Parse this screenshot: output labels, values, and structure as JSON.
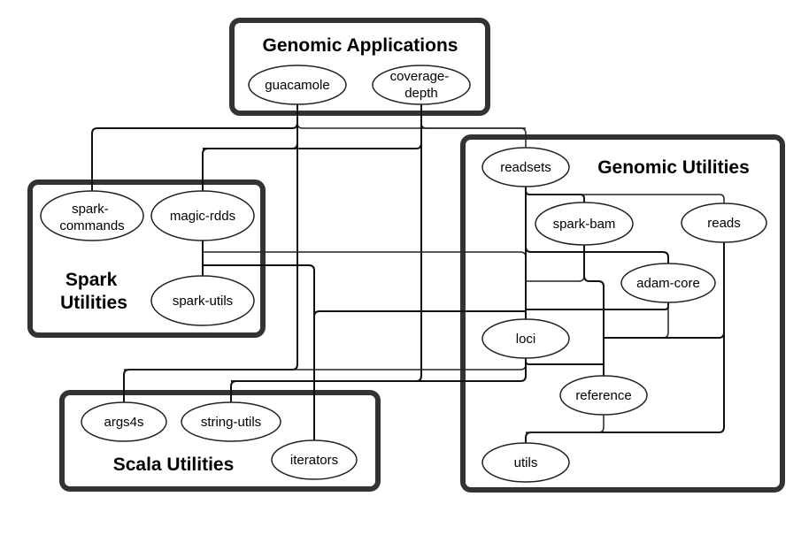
{
  "diagram": {
    "groups": [
      {
        "id": "genomic-applications",
        "title": [
          "Genomic Applications"
        ]
      },
      {
        "id": "spark-utilities",
        "title": [
          "Spark",
          "Utilities"
        ]
      },
      {
        "id": "genomic-utilities",
        "title": [
          "Genomic Utilities"
        ]
      },
      {
        "id": "scala-utilities",
        "title": [
          "Scala Utilities"
        ]
      }
    ],
    "nodes": [
      {
        "id": "guacamole",
        "group": "genomic-applications",
        "label": [
          "guacamole"
        ]
      },
      {
        "id": "coverage-depth",
        "group": "genomic-applications",
        "label": [
          "coverage-",
          "depth"
        ]
      },
      {
        "id": "spark-commands",
        "group": "spark-utilities",
        "label": [
          "spark-",
          "commands"
        ]
      },
      {
        "id": "magic-rdds",
        "group": "spark-utilities",
        "label": [
          "magic-rdds"
        ]
      },
      {
        "id": "spark-utils",
        "group": "spark-utilities",
        "label": [
          "spark-utils"
        ]
      },
      {
        "id": "readsets",
        "group": "genomic-utilities",
        "label": [
          "readsets"
        ]
      },
      {
        "id": "spark-bam",
        "group": "genomic-utilities",
        "label": [
          "spark-bam"
        ]
      },
      {
        "id": "reads",
        "group": "genomic-utilities",
        "label": [
          "reads"
        ]
      },
      {
        "id": "adam-core",
        "group": "genomic-utilities",
        "label": [
          "adam-core"
        ]
      },
      {
        "id": "loci",
        "group": "genomic-utilities",
        "label": [
          "loci"
        ]
      },
      {
        "id": "reference",
        "group": "genomic-utilities",
        "label": [
          "reference"
        ]
      },
      {
        "id": "utils",
        "group": "genomic-utilities",
        "label": [
          "utils"
        ]
      },
      {
        "id": "args4s",
        "group": "scala-utilities",
        "label": [
          "args4s"
        ]
      },
      {
        "id": "string-utils",
        "group": "scala-utilities",
        "label": [
          "string-utils"
        ]
      },
      {
        "id": "iterators",
        "group": "scala-utilities",
        "label": [
          "iterators"
        ]
      }
    ],
    "edges": [
      {
        "from": "guacamole",
        "to": "spark-commands"
      },
      {
        "from": "guacamole",
        "to": "magic-rdds"
      },
      {
        "from": "guacamole",
        "to": "readsets"
      },
      {
        "from": "guacamole",
        "to": "args4s"
      },
      {
        "from": "coverage-depth",
        "to": "magic-rdds"
      },
      {
        "from": "coverage-depth",
        "to": "readsets"
      },
      {
        "from": "coverage-depth",
        "to": "string-utils"
      },
      {
        "from": "magic-rdds",
        "to": "spark-utils"
      },
      {
        "from": "magic-rdds",
        "to": "loci"
      },
      {
        "from": "magic-rdds",
        "to": "iterators"
      },
      {
        "from": "readsets",
        "to": "spark-bam"
      },
      {
        "from": "readsets",
        "to": "reads"
      },
      {
        "from": "readsets",
        "to": "adam-core"
      },
      {
        "from": "readsets",
        "to": "loci"
      },
      {
        "from": "spark-bam",
        "to": "loci"
      },
      {
        "from": "spark-bam",
        "to": "reference"
      },
      {
        "from": "adam-core",
        "to": "loci"
      },
      {
        "from": "adam-core",
        "to": "reference"
      },
      {
        "from": "reads",
        "to": "reference"
      },
      {
        "from": "reads",
        "to": "utils"
      },
      {
        "from": "loci",
        "to": "args4s"
      },
      {
        "from": "loci",
        "to": "string-utils"
      },
      {
        "from": "loci",
        "to": "reference"
      },
      {
        "from": "reference",
        "to": "utils"
      },
      {
        "from": "iterators",
        "to": "loci"
      }
    ]
  }
}
